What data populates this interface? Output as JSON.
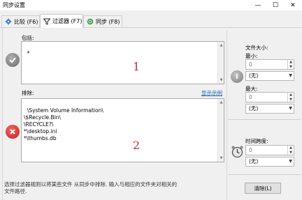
{
  "window": {
    "title": "同步设置",
    "minimize_glyph": "—",
    "maximize_glyph": "☐",
    "close_glyph": "✕"
  },
  "tabs": [
    {
      "label": "比较 (F6)",
      "icon": "gear-icon",
      "active": false
    },
    {
      "label": "过滤器 (F7)",
      "icon": "filter-icon",
      "active": true
    },
    {
      "label": "同步 (F8)",
      "icon": "sync-icon",
      "active": false
    }
  ],
  "include": {
    "label": "包括:",
    "value": "*",
    "annotation": "1"
  },
  "exclude": {
    "label": "排除:",
    "show_examples_link": "显示示例",
    "lines": "\\System Volume Information\\\n\\$Recycle.Bin\\\n\\RECYCLE?\\\n*\\desktop.ini\n*\\thumbs.db",
    "annotation": "2"
  },
  "file_size": {
    "heading": "文件大小:",
    "min_label": "最小:",
    "min_value": "0",
    "min_unit": "(无)",
    "max_label": "最大:",
    "max_value": "0",
    "max_unit": "(无)"
  },
  "time_span": {
    "heading": "时间跨度:",
    "value": "0",
    "unit": "(无)"
  },
  "hint_text": "选择过滤器规则以将某些文件 从同步中排除. 输入与相应的文件夹对相关的\n文件路径.",
  "clear_button": "清除(L)",
  "colors": {
    "annotation_red": "#c03030",
    "link_blue": "#1a5fb4",
    "include_icon": "#7a7a7a",
    "exclude_icon": "#d0312d"
  }
}
